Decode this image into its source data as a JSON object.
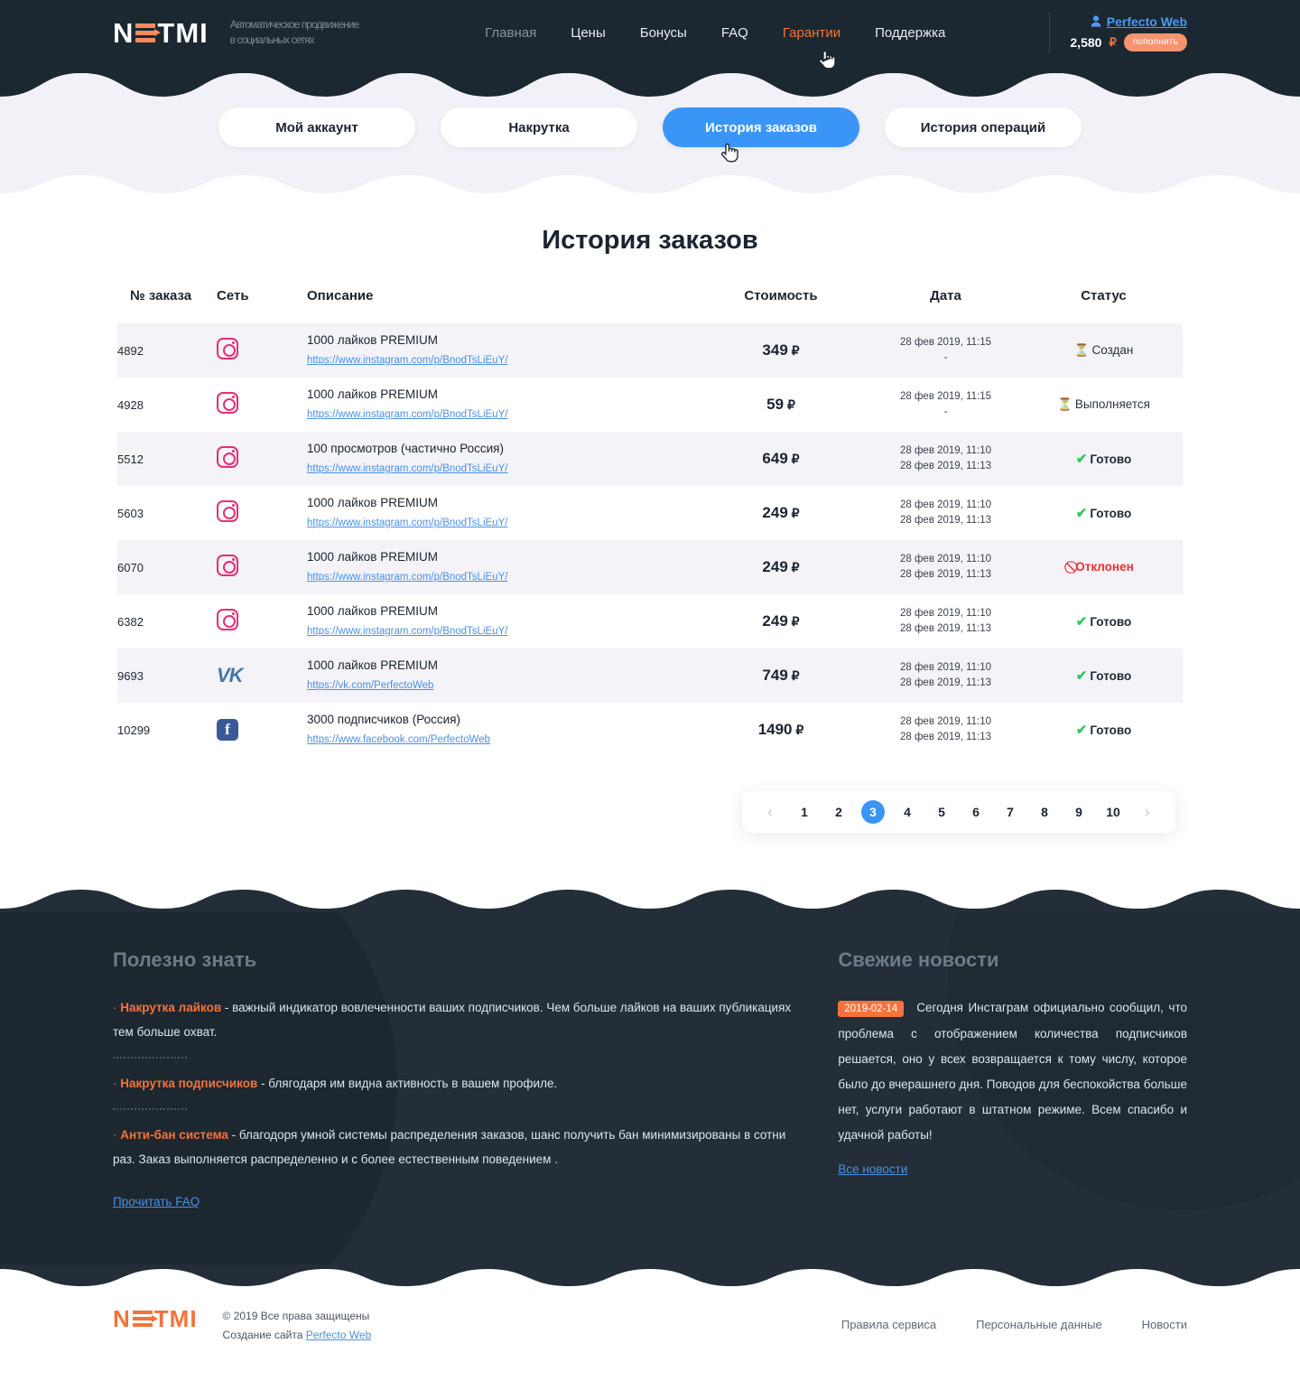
{
  "brand": {
    "name": "NETMI",
    "tagline_line1": "Автоматическое продвижение",
    "tagline_line2": "в социальных сетях"
  },
  "header": {
    "nav": [
      {
        "label": "Главная",
        "state": "muted"
      },
      {
        "label": "Цены",
        "state": "normal"
      },
      {
        "label": "Бонусы",
        "state": "normal"
      },
      {
        "label": "FAQ",
        "state": "normal"
      },
      {
        "label": "Гарантии",
        "state": "active"
      },
      {
        "label": "Поддержка",
        "state": "normal"
      }
    ],
    "account": {
      "user_icon": "user-icon",
      "username": "Perfecto Web",
      "balance": "2,580",
      "currency": "₽",
      "topup_label": "пополнить"
    }
  },
  "tabs": [
    {
      "label": "Мой аккаунт",
      "active": false
    },
    {
      "label": "Накрутка",
      "active": false
    },
    {
      "label": "История заказов",
      "active": true
    },
    {
      "label": "История операций",
      "active": false
    }
  ],
  "main": {
    "title": "История заказов",
    "columns": {
      "id": "№ заказа",
      "network": "Сеть",
      "description": "Описание",
      "price": "Стоимость",
      "date": "Дата",
      "status": "Статус"
    },
    "rows": [
      {
        "id": "4892",
        "network": "instagram",
        "desc": "1000 лайков PREMIUM",
        "link": "https://www.instagram.com/p/BnodTsLiEuY/",
        "price": "349",
        "currency": "₽",
        "date1": "28 фев 2019, 11:15",
        "date2": "-",
        "status": "Создан",
        "status_kind": "created"
      },
      {
        "id": "4928",
        "network": "instagram",
        "desc": "1000 лайков PREMIUM",
        "link": "https://www.instagram.com/p/BnodTsLiEuY/",
        "price": "59",
        "currency": "₽",
        "date1": "28 фев 2019, 11:15",
        "date2": "-",
        "status": "Выполняется",
        "status_kind": "progress"
      },
      {
        "id": "5512",
        "network": "instagram",
        "desc": "100 просмотров (частично Россия)",
        "link": "https://www.instagram.com/p/BnodTsLiEuY/",
        "price": "649",
        "currency": "₽",
        "date1": "28 фев 2019, 11:10",
        "date2": "28 фев 2019, 11:13",
        "status": "Готово",
        "status_kind": "done"
      },
      {
        "id": "5603",
        "network": "instagram",
        "desc": "1000 лайков PREMIUM",
        "link": "https://www.instagram.com/p/BnodTsLiEuY/",
        "price": "249",
        "currency": "₽",
        "date1": "28 фев 2019, 11:10",
        "date2": "28 фев 2019, 11:13",
        "status": "Готово",
        "status_kind": "done"
      },
      {
        "id": "6070",
        "network": "instagram",
        "desc": "1000 лайков PREMIUM",
        "link": "https://www.instagram.com/p/BnodTsLiEuY/",
        "price": "249",
        "currency": "₽",
        "date1": "28 фев 2019, 11:10",
        "date2": "28 фев 2019, 11:13",
        "status": "Отклонен",
        "status_kind": "rejected"
      },
      {
        "id": "6382",
        "network": "instagram",
        "desc": "1000 лайков PREMIUM",
        "link": "https://www.instagram.com/p/BnodTsLiEuY/",
        "price": "249",
        "currency": "₽",
        "date1": "28 фев 2019, 11:10",
        "date2": "28 фев 2019, 11:13",
        "status": "Готово",
        "status_kind": "done"
      },
      {
        "id": "9693",
        "network": "vk",
        "desc": "1000 лайков PREMIUM",
        "link": "https://vk.com/PerfectoWeb",
        "price": "749",
        "currency": "₽",
        "date1": "28 фев 2019, 11:10",
        "date2": "28 фев 2019, 11:13",
        "status": "Готово",
        "status_kind": "done"
      },
      {
        "id": "10299",
        "network": "facebook",
        "desc": "3000 подписчиков (Россия)",
        "link": "https://www.facebook.com/PerfectoWeb",
        "price": "1490",
        "currency": "₽",
        "date1": "28 фев 2019, 11:10",
        "date2": "28 фев 2019, 11:13",
        "status": "Готово",
        "status_kind": "done"
      }
    ],
    "pagination": {
      "prev_icon": "chevron-left-icon",
      "next_icon": "chevron-right-icon",
      "pages": [
        "1",
        "2",
        "3",
        "4",
        "5",
        "6",
        "7",
        "8",
        "9",
        "10"
      ],
      "current": "3"
    }
  },
  "footer": {
    "useful": {
      "heading": "Полезно знать",
      "items": [
        {
          "term": "Накрутка лайков",
          "text": " - важный индикатор вовлеченности  ваших подписчиков. Чем больше лайков на ваших публикациях тем больше охват."
        },
        {
          "term": "Накрутка подписчиков",
          "text": " - блягодаря им видна активность в вашем профиле."
        },
        {
          "term": "Анти-бан система",
          "text": " - благодоря умной системы распределения заказов, шанс получить бан минимизированы в сотни раз. Заказ выполняется распределенно и с более естественным поведением ."
        }
      ],
      "faq_link": "Прочитать FAQ"
    },
    "news": {
      "heading": "Свежие новости",
      "date": "2019-02-14",
      "text": "Сегодня Инстаграм официально сообщил, что проблема с отображением количества подписчиков решается, оно у всех возвращается к тому числу, которое было до вчерашнего дня. Поводов для беспокойства больше нет, услуги работают в штатном режиме. Всем спасибо и удачной работы!",
      "all_link": "Все новости"
    },
    "bottom": {
      "copyright": "© 2019 Все права защищены",
      "made_by_prefix": "Создание сайта ",
      "made_by_link": "Perfecto Web",
      "links": [
        "Правила сервиса",
        "Персональные данные",
        "Новости"
      ]
    }
  },
  "colors": {
    "dark": "#1b2831",
    "footer_dark": "#232e38",
    "band": "#f1f1f7",
    "accent_blue": "#3b95f6",
    "accent_orange": "#f4733b",
    "status_done": "#35c759",
    "status_rejected": "#ee2f2f",
    "instagram": "#e62e74",
    "vk": "#4a76a8",
    "facebook": "#3b5998"
  }
}
